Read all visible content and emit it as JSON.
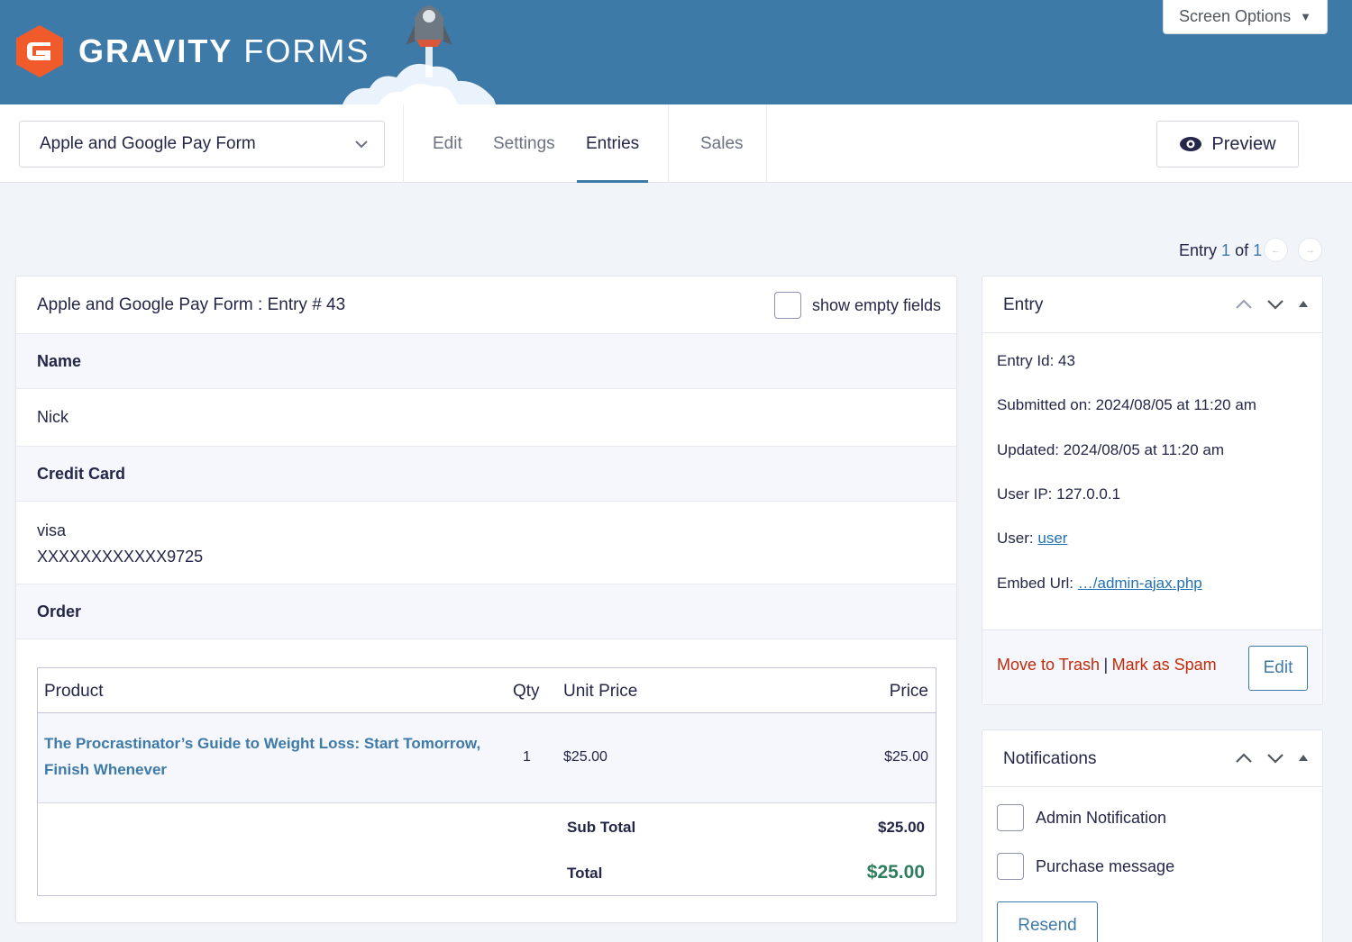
{
  "header": {
    "logo_bold": "GRAVITY",
    "logo_light": "FORMS",
    "screen_options": "Screen Options"
  },
  "toolbar": {
    "form_name": "Apple and Google Pay Form",
    "tabs": [
      {
        "label": "Edit"
      },
      {
        "label": "Settings"
      },
      {
        "label": "Entries"
      },
      {
        "label": "Sales"
      }
    ],
    "active_tab": "Entries",
    "preview_label": "Preview"
  },
  "pager": {
    "prefix": "Entry",
    "current": "1",
    "of": "of",
    "total": "1"
  },
  "entry": {
    "title": "Apple and Google Pay Form : Entry # 43",
    "show_empty_label": "show empty fields",
    "fields": [
      {
        "label": "Name",
        "value": "Nick"
      },
      {
        "label": "Credit Card",
        "value_line1": "visa",
        "value_line2": "XXXXXXXXXXXX9725"
      },
      {
        "label": "Order"
      }
    ],
    "order": {
      "headers": {
        "product": "Product",
        "qty": "Qty",
        "unit_price": "Unit Price",
        "price": "Price"
      },
      "items": [
        {
          "product_line1": "The Procrastinator’s Guide to Weight Loss: Start Tomorrow,",
          "product_line2": "Finish Whenever",
          "qty": "1",
          "unit_price": "$25.00",
          "price": "$25.00"
        }
      ],
      "subtotal_label": "Sub Total",
      "subtotal": "$25.00",
      "total_label": "Total",
      "total": "$25.00"
    }
  },
  "sidebar": {
    "entry_box": {
      "title": "Entry",
      "entry_id": "Entry Id: 43",
      "submitted": "Submitted on: 2024/08/05 at 11:20 am",
      "updated": "Updated: 2024/08/05 at 11:20 am",
      "user_ip": "User IP: 127.0.0.1",
      "user_label": "User:",
      "user_link": "user",
      "embed_label": "Embed Url:",
      "embed_link": "…/admin-ajax.php",
      "trash": "Move to Trash",
      "separator": "|",
      "spam": "Mark as Spam",
      "edit": "Edit"
    },
    "notifications_box": {
      "title": "Notifications",
      "items": [
        {
          "label": "Admin Notification"
        },
        {
          "label": "Purchase message"
        }
      ],
      "resend": "Resend"
    }
  },
  "colors": {
    "header_bg": "#3e7aa8",
    "brand_orange": "#f15a2b",
    "link_blue": "#2271b1",
    "danger_red": "#c02b0a",
    "total_green": "#2e7d5b"
  }
}
